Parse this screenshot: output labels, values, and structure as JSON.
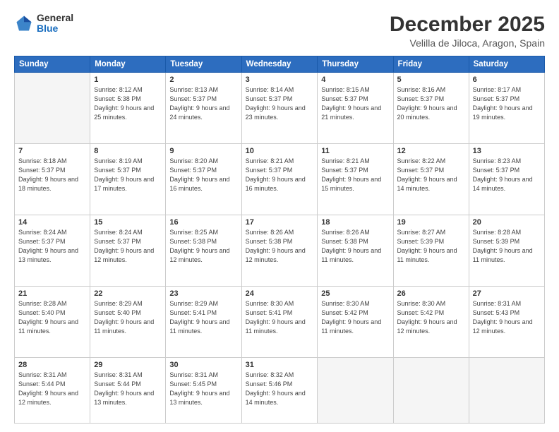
{
  "logo": {
    "general": "General",
    "blue": "Blue"
  },
  "title": "December 2025",
  "subtitle": "Velilla de Jiloca, Aragon, Spain",
  "days_of_week": [
    "Sunday",
    "Monday",
    "Tuesday",
    "Wednesday",
    "Thursday",
    "Friday",
    "Saturday"
  ],
  "weeks": [
    [
      {
        "day": "",
        "sunrise": "",
        "sunset": "",
        "daylight": ""
      },
      {
        "day": "1",
        "sunrise": "Sunrise: 8:12 AM",
        "sunset": "Sunset: 5:38 PM",
        "daylight": "Daylight: 9 hours and 25 minutes."
      },
      {
        "day": "2",
        "sunrise": "Sunrise: 8:13 AM",
        "sunset": "Sunset: 5:37 PM",
        "daylight": "Daylight: 9 hours and 24 minutes."
      },
      {
        "day": "3",
        "sunrise": "Sunrise: 8:14 AM",
        "sunset": "Sunset: 5:37 PM",
        "daylight": "Daylight: 9 hours and 23 minutes."
      },
      {
        "day": "4",
        "sunrise": "Sunrise: 8:15 AM",
        "sunset": "Sunset: 5:37 PM",
        "daylight": "Daylight: 9 hours and 21 minutes."
      },
      {
        "day": "5",
        "sunrise": "Sunrise: 8:16 AM",
        "sunset": "Sunset: 5:37 PM",
        "daylight": "Daylight: 9 hours and 20 minutes."
      },
      {
        "day": "6",
        "sunrise": "Sunrise: 8:17 AM",
        "sunset": "Sunset: 5:37 PM",
        "daylight": "Daylight: 9 hours and 19 minutes."
      }
    ],
    [
      {
        "day": "7",
        "sunrise": "Sunrise: 8:18 AM",
        "sunset": "Sunset: 5:37 PM",
        "daylight": "Daylight: 9 hours and 18 minutes."
      },
      {
        "day": "8",
        "sunrise": "Sunrise: 8:19 AM",
        "sunset": "Sunset: 5:37 PM",
        "daylight": "Daylight: 9 hours and 17 minutes."
      },
      {
        "day": "9",
        "sunrise": "Sunrise: 8:20 AM",
        "sunset": "Sunset: 5:37 PM",
        "daylight": "Daylight: 9 hours and 16 minutes."
      },
      {
        "day": "10",
        "sunrise": "Sunrise: 8:21 AM",
        "sunset": "Sunset: 5:37 PM",
        "daylight": "Daylight: 9 hours and 16 minutes."
      },
      {
        "day": "11",
        "sunrise": "Sunrise: 8:21 AM",
        "sunset": "Sunset: 5:37 PM",
        "daylight": "Daylight: 9 hours and 15 minutes."
      },
      {
        "day": "12",
        "sunrise": "Sunrise: 8:22 AM",
        "sunset": "Sunset: 5:37 PM",
        "daylight": "Daylight: 9 hours and 14 minutes."
      },
      {
        "day": "13",
        "sunrise": "Sunrise: 8:23 AM",
        "sunset": "Sunset: 5:37 PM",
        "daylight": "Daylight: 9 hours and 14 minutes."
      }
    ],
    [
      {
        "day": "14",
        "sunrise": "Sunrise: 8:24 AM",
        "sunset": "Sunset: 5:37 PM",
        "daylight": "Daylight: 9 hours and 13 minutes."
      },
      {
        "day": "15",
        "sunrise": "Sunrise: 8:24 AM",
        "sunset": "Sunset: 5:37 PM",
        "daylight": "Daylight: 9 hours and 12 minutes."
      },
      {
        "day": "16",
        "sunrise": "Sunrise: 8:25 AM",
        "sunset": "Sunset: 5:38 PM",
        "daylight": "Daylight: 9 hours and 12 minutes."
      },
      {
        "day": "17",
        "sunrise": "Sunrise: 8:26 AM",
        "sunset": "Sunset: 5:38 PM",
        "daylight": "Daylight: 9 hours and 12 minutes."
      },
      {
        "day": "18",
        "sunrise": "Sunrise: 8:26 AM",
        "sunset": "Sunset: 5:38 PM",
        "daylight": "Daylight: 9 hours and 11 minutes."
      },
      {
        "day": "19",
        "sunrise": "Sunrise: 8:27 AM",
        "sunset": "Sunset: 5:39 PM",
        "daylight": "Daylight: 9 hours and 11 minutes."
      },
      {
        "day": "20",
        "sunrise": "Sunrise: 8:28 AM",
        "sunset": "Sunset: 5:39 PM",
        "daylight": "Daylight: 9 hours and 11 minutes."
      }
    ],
    [
      {
        "day": "21",
        "sunrise": "Sunrise: 8:28 AM",
        "sunset": "Sunset: 5:40 PM",
        "daylight": "Daylight: 9 hours and 11 minutes."
      },
      {
        "day": "22",
        "sunrise": "Sunrise: 8:29 AM",
        "sunset": "Sunset: 5:40 PM",
        "daylight": "Daylight: 9 hours and 11 minutes."
      },
      {
        "day": "23",
        "sunrise": "Sunrise: 8:29 AM",
        "sunset": "Sunset: 5:41 PM",
        "daylight": "Daylight: 9 hours and 11 minutes."
      },
      {
        "day": "24",
        "sunrise": "Sunrise: 8:30 AM",
        "sunset": "Sunset: 5:41 PM",
        "daylight": "Daylight: 9 hours and 11 minutes."
      },
      {
        "day": "25",
        "sunrise": "Sunrise: 8:30 AM",
        "sunset": "Sunset: 5:42 PM",
        "daylight": "Daylight: 9 hours and 11 minutes."
      },
      {
        "day": "26",
        "sunrise": "Sunrise: 8:30 AM",
        "sunset": "Sunset: 5:42 PM",
        "daylight": "Daylight: 9 hours and 12 minutes."
      },
      {
        "day": "27",
        "sunrise": "Sunrise: 8:31 AM",
        "sunset": "Sunset: 5:43 PM",
        "daylight": "Daylight: 9 hours and 12 minutes."
      }
    ],
    [
      {
        "day": "28",
        "sunrise": "Sunrise: 8:31 AM",
        "sunset": "Sunset: 5:44 PM",
        "daylight": "Daylight: 9 hours and 12 minutes."
      },
      {
        "day": "29",
        "sunrise": "Sunrise: 8:31 AM",
        "sunset": "Sunset: 5:44 PM",
        "daylight": "Daylight: 9 hours and 13 minutes."
      },
      {
        "day": "30",
        "sunrise": "Sunrise: 8:31 AM",
        "sunset": "Sunset: 5:45 PM",
        "daylight": "Daylight: 9 hours and 13 minutes."
      },
      {
        "day": "31",
        "sunrise": "Sunrise: 8:32 AM",
        "sunset": "Sunset: 5:46 PM",
        "daylight": "Daylight: 9 hours and 14 minutes."
      },
      {
        "day": "",
        "sunrise": "",
        "sunset": "",
        "daylight": ""
      },
      {
        "day": "",
        "sunrise": "",
        "sunset": "",
        "daylight": ""
      },
      {
        "day": "",
        "sunrise": "",
        "sunset": "",
        "daylight": ""
      }
    ]
  ]
}
